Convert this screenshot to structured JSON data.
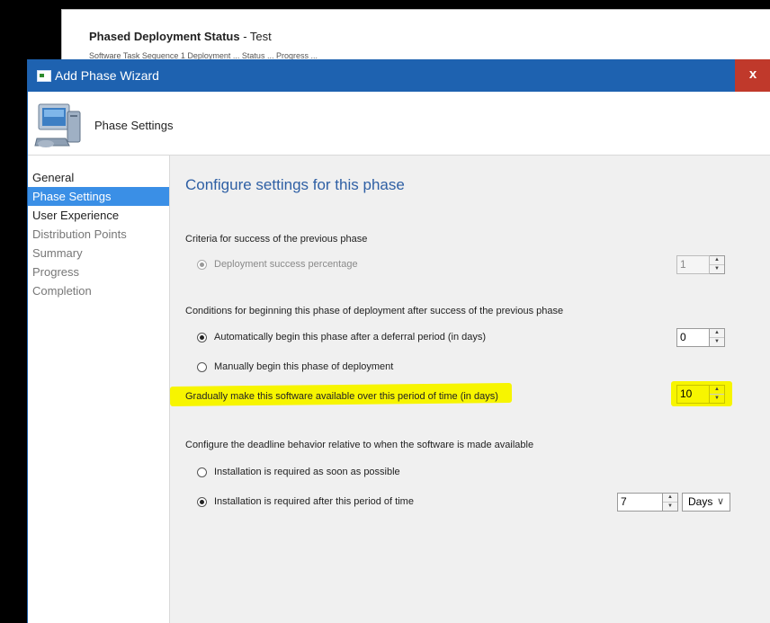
{
  "background_window": {
    "title_bold": "Phased Deployment Status",
    "title_suffix": " - Test",
    "subtitle": "Software Task Sequence 1 Deployment ... Status ... Progress ..."
  },
  "wizard": {
    "title": "Add Phase Wizard",
    "close_label": "x",
    "header_title": "Phase Settings",
    "nav": [
      {
        "label": "General",
        "state": "normal"
      },
      {
        "label": "Phase Settings",
        "state": "active"
      },
      {
        "label": "User Experience",
        "state": "normal"
      },
      {
        "label": "Distribution Points",
        "state": "disabled"
      },
      {
        "label": "Summary",
        "state": "disabled"
      },
      {
        "label": "Progress",
        "state": "disabled"
      },
      {
        "label": "Completion",
        "state": "disabled"
      }
    ],
    "content": {
      "heading": "Configure settings for this phase",
      "criteria_label": "Criteria for success of the previous phase",
      "success_option": "Deployment success percentage",
      "success_value": "1",
      "conditions_label": "Conditions for beginning this phase of deployment after success of the previous phase",
      "auto_option": "Automatically begin this phase after a deferral period (in days)",
      "auto_value": "0",
      "manual_option": "Manually begin this phase of deployment",
      "gradual_label": "Gradually make this software available over this period of time (in days)",
      "gradual_value": "10",
      "deadline_label": "Configure the deadline behavior relative to when the software is made available",
      "asap_option": "Installation is required as soon as possible",
      "after_option": "Installation is required after this period of time",
      "after_value": "7",
      "after_unit": "Days"
    }
  },
  "colors": {
    "titlebar": "#1e62b0",
    "close": "#c0392b",
    "nav_active": "#3a8fe6",
    "heading": "#2e5fa4",
    "highlight": "#f7f500"
  }
}
